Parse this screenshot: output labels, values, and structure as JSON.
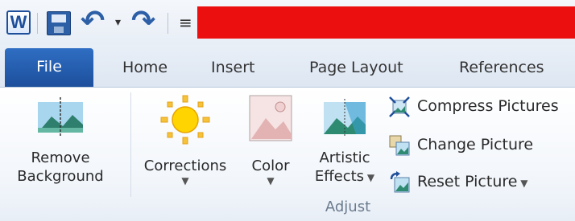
{
  "qat": {
    "app_icon_letter": "W",
    "customize_glyph": "|≡"
  },
  "tabs": {
    "file": "File",
    "home": "Home",
    "insert": "Insert",
    "page_layout": "Page Layout",
    "references": "References"
  },
  "adjust": {
    "remove_background": [
      "Remove",
      "Background"
    ],
    "corrections": "Corrections",
    "color": "Color",
    "artistic_effects": [
      "Artistic",
      "Effects"
    ],
    "compress_pictures": "Compress Pictures",
    "change_picture": "Change Picture",
    "reset_picture": "Reset Picture",
    "group_label": "Adjust"
  },
  "colors": {
    "file_tab": "#2a63b3",
    "title_bar": "#ec0f0f",
    "ribbon_bg": "#f2f6fb"
  }
}
